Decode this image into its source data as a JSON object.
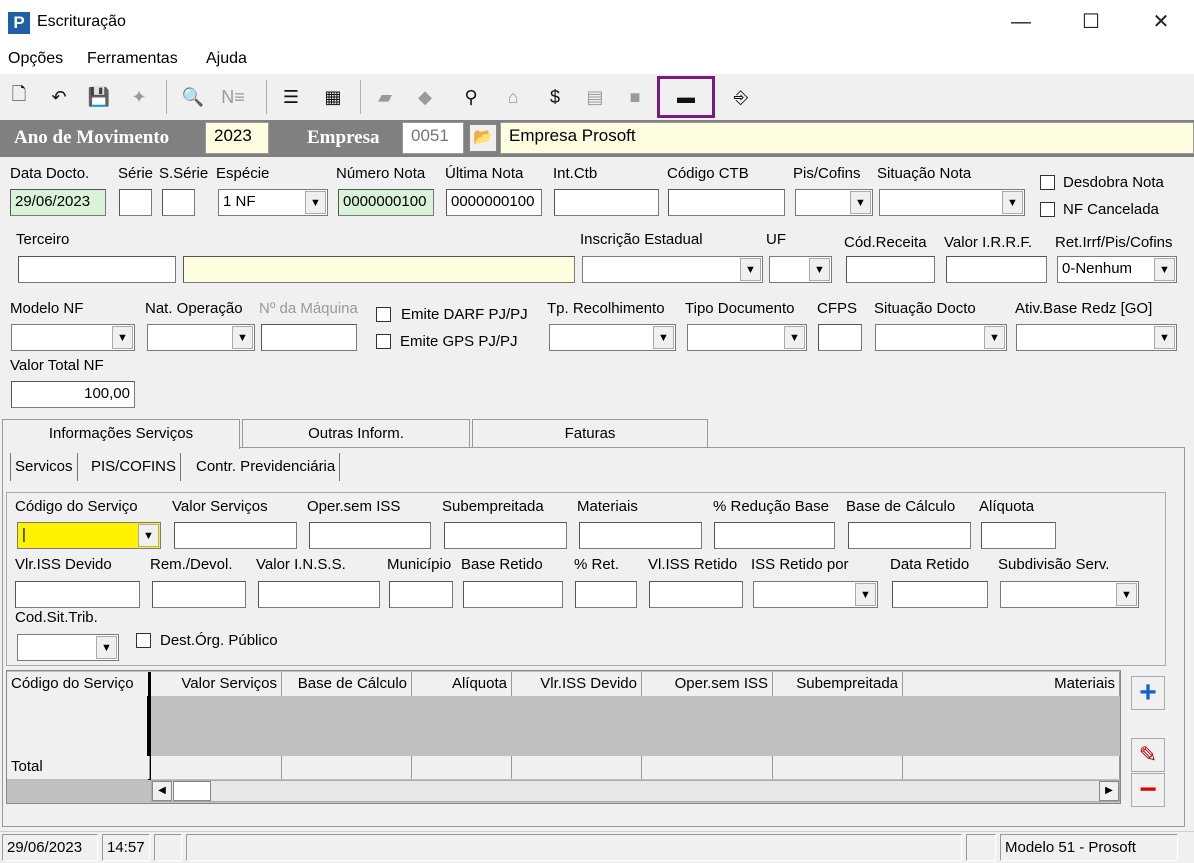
{
  "window": {
    "title": "Escrituração",
    "minimize": "—",
    "maximize": "☐",
    "close": "✕"
  },
  "menu": [
    "Opções",
    "Ferramentas",
    "Ajuda"
  ],
  "header": {
    "ano_label": "Ano de Movimento",
    "ano_value": "2023",
    "empresa_label": "Empresa",
    "empresa_code": "0051",
    "empresa_name": "Empresa Prosoft"
  },
  "form": {
    "data_docto_label": "Data Docto.",
    "data_docto": "29/06/2023",
    "serie_label": "Série",
    "sserie_label": "S.Série",
    "especie_label": "Espécie",
    "especie": "1 NF",
    "numero_nota_label": "Número Nota",
    "numero_nota": "0000000100",
    "ultima_nota_label": "Última Nota",
    "ultima_nota": "0000000100",
    "int_ctb_label": "Int.Ctb",
    "codigo_ctb_label": "Código CTB",
    "pis_cofins_label": "Pis/Cofins",
    "situacao_nota_label": "Situação Nota",
    "desdobra_label": "Desdobra Nota",
    "nf_cancelada_label": "NF Cancelada",
    "terceiro_label": "Terceiro",
    "insc_estadual_label": "Inscrição Estadual",
    "uf_label": "UF",
    "cod_receita_label": "Cód.Receita",
    "valor_irrf_label": "Valor I.R.R.F.",
    "ret_irrf_label": "Ret.Irrf/Pis/Cofins",
    "ret_irrf": "0-Nenhum",
    "modelo_nf_label": "Modelo NF",
    "nat_operacao_label": "Nat. Operação",
    "num_maquina_label": "Nº da Máquina",
    "emite_darf_label": "Emite DARF PJ/PJ",
    "emite_gps_label": "Emite GPS PJ/PJ",
    "tp_recolhimento_label": "Tp. Recolhimento",
    "tipo_documento_label": "Tipo Documento",
    "cfps_label": "CFPS",
    "situacao_docto_label": "Situação Docto",
    "ativ_base_label": "Ativ.Base Redz [GO]",
    "valor_total_label": "Valor Total NF",
    "valor_total": "100,00"
  },
  "tabs": [
    "Informações Serviços",
    "Outras Inform.",
    "Faturas"
  ],
  "subtabs": [
    "Servicos",
    "PIS/COFINS",
    "Contr. Previdenciária"
  ],
  "servicos": {
    "codigo_servico": "Código do Serviço",
    "valor_servicos": "Valor Serviços",
    "oper_sem_iss": "Oper.sem ISS",
    "subempreitada": "Subempreitada",
    "materiais": "Materiais",
    "perc_reducao": "% Redução Base",
    "base_calculo": "Base de Cálculo",
    "aliquota": "Alíquota",
    "vlr_iss_devido": "Vlr.ISS Devido",
    "rem_devol": "Rem./Devol.",
    "valor_inss": "Valor I.N.S.S.",
    "municipio": "Município",
    "base_retido": "Base Retido",
    "perc_ret": "% Ret.",
    "vl_iss_retido": "Vl.ISS Retido",
    "iss_retido_por": "ISS Retido por",
    "data_retido": "Data Retido",
    "subdivisao": "Subdivisão Serv.",
    "cod_sit_trib": "Cod.Sit.Trib.",
    "dest_org": "Dest.Órg. Público"
  },
  "grid": {
    "columns": [
      "Código do Serviço",
      "Valor Serviços",
      "Base de Cálculo",
      "Alíquota",
      "Vlr.ISS Devido",
      "Oper.sem ISS",
      "Subempreitada",
      "Materiais"
    ],
    "total_label": "Total"
  },
  "status": {
    "date": "29/06/2023",
    "time": "14:57",
    "model": "Modelo 51 - Prosoft"
  }
}
